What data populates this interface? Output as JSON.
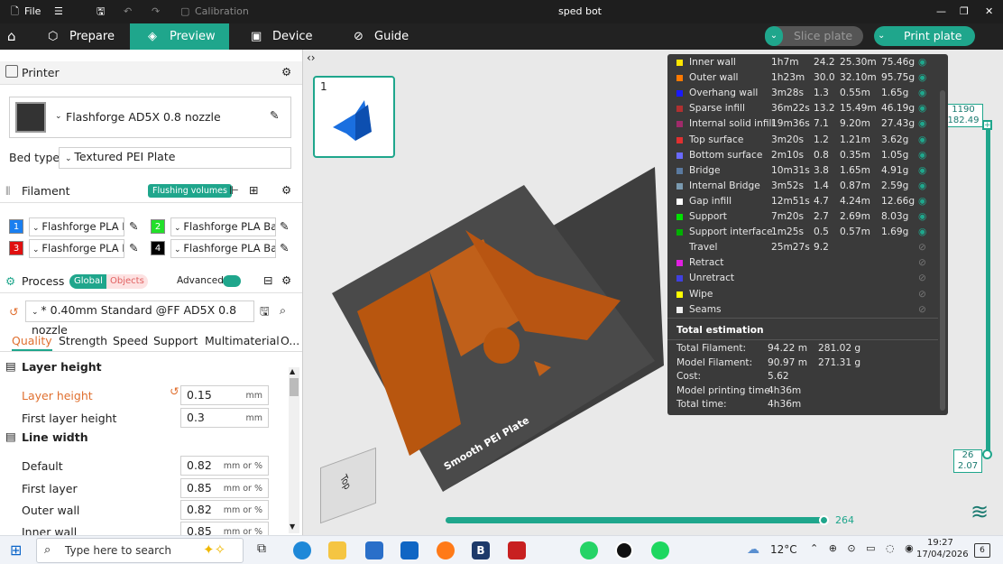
{
  "window": {
    "title": "sped bot",
    "file": "File",
    "calibration": "Calibration"
  },
  "nav": {
    "tabs": [
      "Prepare",
      "Preview",
      "Device",
      "Guide"
    ],
    "slice_plate": "Slice plate",
    "print_plate": "Print plate"
  },
  "printer": {
    "section": "Printer",
    "model": "Flashforge AD5X 0.8 nozzle",
    "bed_type_label": "Bed type",
    "bed_type": "Textured PEI Plate"
  },
  "filament": {
    "section": "Filament",
    "flushing": "Flushing volumes",
    "slots": [
      {
        "n": "1",
        "color": "#1a7ff0",
        "name": "Flashforge PLA B..."
      },
      {
        "n": "2",
        "color": "#22e02a",
        "name": "Flashforge PLA Basic"
      },
      {
        "n": "3",
        "color": "#e01010",
        "name": "Flashforge PLA B..."
      },
      {
        "n": "4",
        "color": "#000000",
        "name": "Flashforge PLA Basic"
      }
    ]
  },
  "process": {
    "section": "Process",
    "global": "Global",
    "objects": "Objects",
    "advanced": "Advanced",
    "profile": "* 0.40mm Standard @FF AD5X 0.8 nozzle",
    "tabs": [
      "Quality",
      "Strength",
      "Speed",
      "Support",
      "Multimaterial",
      "O..."
    ],
    "layer_height_group": "Layer height",
    "line_width_group": "Line width",
    "fields": [
      {
        "label": "Layer height",
        "value": "0.15",
        "unit": "mm"
      },
      {
        "label": "First layer height",
        "value": "0.3",
        "unit": "mm"
      },
      {
        "label": "Default",
        "value": "0.82",
        "unit": "mm or %"
      },
      {
        "label": "First layer",
        "value": "0.85",
        "unit": "mm or %"
      },
      {
        "label": "Outer wall",
        "value": "0.82",
        "unit": "mm or %"
      },
      {
        "label": "Inner wall",
        "value": "0.85",
        "unit": "mm or %"
      }
    ]
  },
  "plate": {
    "number": "1",
    "label": "Smooth PEI Plate",
    "cube": "Top"
  },
  "stats": {
    "rows": [
      {
        "name": "Inner wall",
        "color": "#ffe600",
        "time": "1h7m",
        "pct": "24.2",
        "len": "25.30m",
        "wt": "75.46g",
        "visible": true
      },
      {
        "name": "Outer wall",
        "color": "#ff7a00",
        "time": "1h23m",
        "pct": "30.0",
        "len": "32.10m",
        "wt": "95.75g",
        "visible": true
      },
      {
        "name": "Overhang wall",
        "color": "#1a1aff",
        "time": "3m28s",
        "pct": "1.3",
        "len": "0.55m",
        "wt": "1.65g",
        "visible": true
      },
      {
        "name": "Sparse infill",
        "color": "#b03030",
        "time": "36m22s",
        "pct": "13.2",
        "len": "15.49m",
        "wt": "46.19g",
        "visible": true
      },
      {
        "name": "Internal solid infill",
        "color": "#a02a6a",
        "time": "19m36s",
        "pct": "7.1",
        "len": "9.20m",
        "wt": "27.43g",
        "visible": true
      },
      {
        "name": "Top surface",
        "color": "#e03030",
        "time": "3m20s",
        "pct": "1.2",
        "len": "1.21m",
        "wt": "3.62g",
        "visible": true
      },
      {
        "name": "Bottom surface",
        "color": "#6a6aff",
        "time": "2m10s",
        "pct": "0.8",
        "len": "0.35m",
        "wt": "1.05g",
        "visible": true
      },
      {
        "name": "Bridge",
        "color": "#5a7aa0",
        "time": "10m31s",
        "pct": "3.8",
        "len": "1.65m",
        "wt": "4.91g",
        "visible": true
      },
      {
        "name": "Internal Bridge",
        "color": "#7a9ab0",
        "time": "3m52s",
        "pct": "1.4",
        "len": "0.87m",
        "wt": "2.59g",
        "visible": true
      },
      {
        "name": "Gap infill",
        "color": "#ffffff",
        "time": "12m51s",
        "pct": "4.7",
        "len": "4.24m",
        "wt": "12.66g",
        "visible": true
      },
      {
        "name": "Support",
        "color": "#00e000",
        "time": "7m20s",
        "pct": "2.7",
        "len": "2.69m",
        "wt": "8.03g",
        "visible": true
      },
      {
        "name": "Support interface",
        "color": "#00b000",
        "time": "1m25s",
        "pct": "0.5",
        "len": "0.57m",
        "wt": "1.69g",
        "visible": true
      },
      {
        "name": "Travel",
        "color": "",
        "time": "25m27s",
        "pct": "9.2",
        "len": "",
        "wt": "",
        "visible": false
      },
      {
        "name": "Retract",
        "color": "#e020e0",
        "time": "",
        "pct": "",
        "len": "",
        "wt": "",
        "visible": false
      },
      {
        "name": "Unretract",
        "color": "#4040e0",
        "time": "",
        "pct": "",
        "len": "",
        "wt": "",
        "visible": false
      },
      {
        "name": "Wipe",
        "color": "#ffff00",
        "time": "",
        "pct": "",
        "len": "",
        "wt": "",
        "visible": false
      },
      {
        "name": "Seams",
        "color": "#f0f0f0",
        "time": "",
        "pct": "",
        "len": "",
        "wt": "",
        "visible": false
      }
    ],
    "total_title": "Total estimation",
    "totals": [
      {
        "label": "Total Filament:",
        "v1": "94.22 m",
        "v2": "281.02 g"
      },
      {
        "label": "Model Filament:",
        "v1": "90.97 m",
        "v2": "271.31 g"
      },
      {
        "label": "Cost:",
        "v1": "5.62",
        "v2": ""
      },
      {
        "label": "Model printing time:",
        "v1": "4h36m",
        "v2": ""
      },
      {
        "label": "Total time:",
        "v1": "4h36m",
        "v2": ""
      }
    ]
  },
  "layers": {
    "top_layer": "1190",
    "top_height": "182.49",
    "bottom_layer": "26",
    "bottom_height": "2.07"
  },
  "moves": {
    "value": "264"
  },
  "taskbar": {
    "search": "Type here to search",
    "temp": "12°C",
    "time": "19:27",
    "date": "17/04/2026",
    "notif": "6"
  },
  "colors": {
    "accent": "#1fa68c",
    "dark": "#222222"
  }
}
